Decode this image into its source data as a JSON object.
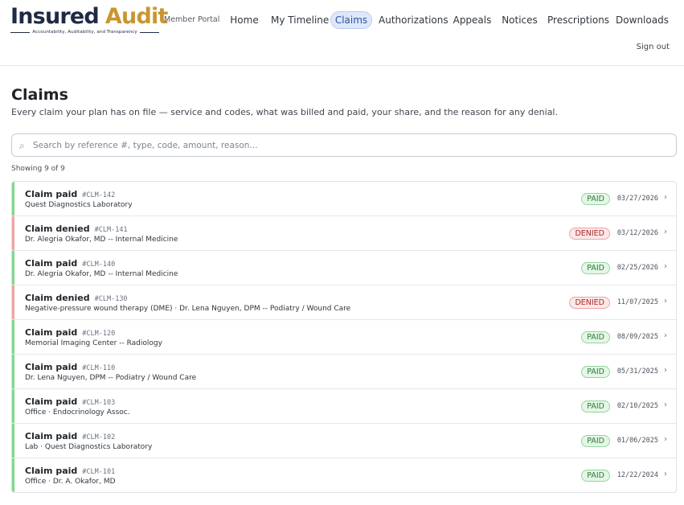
{
  "brand": {
    "word1": "Insured",
    "word2": "Audit",
    "tagline": "Accountability, Auditability, and Transparency",
    "portal_label": "Member Portal",
    "colors": {
      "navy": "#1f2a44",
      "gold": "#c9962f"
    }
  },
  "nav": {
    "items": [
      {
        "label": "Home",
        "active": false
      },
      {
        "label": "My Timeline",
        "active": false
      },
      {
        "label": "Claims",
        "active": true
      },
      {
        "label": "Authorizations",
        "active": false
      },
      {
        "label": "Appeals",
        "active": false
      },
      {
        "label": "Notices",
        "active": false
      },
      {
        "label": "Prescriptions",
        "active": false
      },
      {
        "label": "Downloads",
        "active": false
      }
    ],
    "sign_out": "Sign out"
  },
  "page": {
    "title": "Claims",
    "subtitle": "Every claim your plan has on file — service and codes, what was billed and paid, your share, and the reason for any denial."
  },
  "search": {
    "icon": "search-icon",
    "placeholder": "Search by reference #, type, code, amount, reason...",
    "value": ""
  },
  "results": {
    "count_label": "Showing 9 of 9"
  },
  "status_colors": {
    "paid": "#7fd88a",
    "denied": "#f0a3a3"
  },
  "claims": [
    {
      "title": "Claim paid",
      "ref": "#CLM-142",
      "desc": "Quest Diagnostics Laboratory",
      "status": "PAID",
      "date": "03/27/2026"
    },
    {
      "title": "Claim denied",
      "ref": "#CLM-141",
      "desc": "Dr. Alegria Okafor, MD -- Internal Medicine",
      "status": "DENIED",
      "date": "03/12/2026"
    },
    {
      "title": "Claim paid",
      "ref": "#CLM-140",
      "desc": "Dr. Alegria Okafor, MD -- Internal Medicine",
      "status": "PAID",
      "date": "02/25/2026"
    },
    {
      "title": "Claim denied",
      "ref": "#CLM-130",
      "desc": "Negative-pressure wound therapy (DME) · Dr. Lena Nguyen, DPM -- Podiatry / Wound Care",
      "status": "DENIED",
      "date": "11/07/2025"
    },
    {
      "title": "Claim paid",
      "ref": "#CLM-120",
      "desc": "Memorial Imaging Center -- Radiology",
      "status": "PAID",
      "date": "08/09/2025"
    },
    {
      "title": "Claim paid",
      "ref": "#CLM-110",
      "desc": "Dr. Lena Nguyen, DPM -- Podiatry / Wound Care",
      "status": "PAID",
      "date": "05/31/2025"
    },
    {
      "title": "Claim paid",
      "ref": "#CLM-103",
      "desc": "Office · Endocrinology Assoc.",
      "status": "PAID",
      "date": "02/10/2025"
    },
    {
      "title": "Claim paid",
      "ref": "#CLM-102",
      "desc": "Lab · Quest Diagnostics Laboratory",
      "status": "PAID",
      "date": "01/06/2025"
    },
    {
      "title": "Claim paid",
      "ref": "#CLM-101",
      "desc": "Office · Dr. A. Okafor, MD",
      "status": "PAID",
      "date": "12/22/2024"
    }
  ]
}
